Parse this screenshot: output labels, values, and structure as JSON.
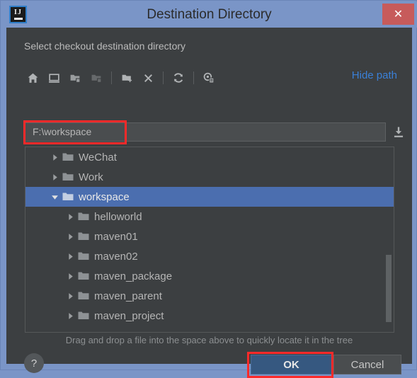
{
  "window": {
    "title": "Destination Directory",
    "app_icon": "intellij-idea-icon",
    "close_label": "✕",
    "titlebar_color": "#7a95c7",
    "body_color": "#3c3f41"
  },
  "subtitle": "Select checkout destination directory",
  "toolbar": {
    "buttons": [
      {
        "name": "home-icon",
        "title": "Home"
      },
      {
        "name": "desktop-icon",
        "title": "Desktop"
      },
      {
        "name": "folder-up-icon",
        "title": "Up"
      },
      {
        "name": "folder-down-icon",
        "title": "Down",
        "disabled": true
      },
      {
        "name": "new-folder-icon",
        "title": "New Folder"
      },
      {
        "name": "delete-icon",
        "title": "Delete"
      },
      {
        "name": "refresh-icon",
        "title": "Refresh"
      },
      {
        "name": "show-hidden-files-icon",
        "title": "Show Hidden Files"
      }
    ],
    "hide_path_label": "Hide path",
    "hide_path_color": "#3a80d8"
  },
  "path_field": {
    "value": "F:\\workspace",
    "placeholder": "",
    "export_icon": "download-icon"
  },
  "tree": {
    "rows": [
      {
        "label": "WeChat",
        "indent": 1,
        "expanded": false,
        "selected": false
      },
      {
        "label": "Work",
        "indent": 1,
        "expanded": false,
        "selected": false
      },
      {
        "label": "workspace",
        "indent": 1,
        "expanded": true,
        "selected": true
      },
      {
        "label": "helloworld",
        "indent": 2,
        "expanded": false,
        "selected": false
      },
      {
        "label": "maven01",
        "indent": 2,
        "expanded": false,
        "selected": false
      },
      {
        "label": "maven02",
        "indent": 2,
        "expanded": false,
        "selected": false
      },
      {
        "label": "maven_package",
        "indent": 2,
        "expanded": false,
        "selected": false
      },
      {
        "label": "maven_parent",
        "indent": 2,
        "expanded": false,
        "selected": false
      },
      {
        "label": "maven_project",
        "indent": 2,
        "expanded": false,
        "selected": false
      }
    ],
    "selected_color": "#4b6eaf"
  },
  "hint": "Drag and drop a file into the space above to quickly locate it in the tree",
  "footer": {
    "help_label": "?",
    "ok_label": "OK",
    "cancel_label": "Cancel",
    "ok_color": "#365880"
  },
  "annotations": {
    "color": "#fc2a2a",
    "boxes": [
      "path-field-highlight",
      "ok-button-highlight"
    ]
  }
}
